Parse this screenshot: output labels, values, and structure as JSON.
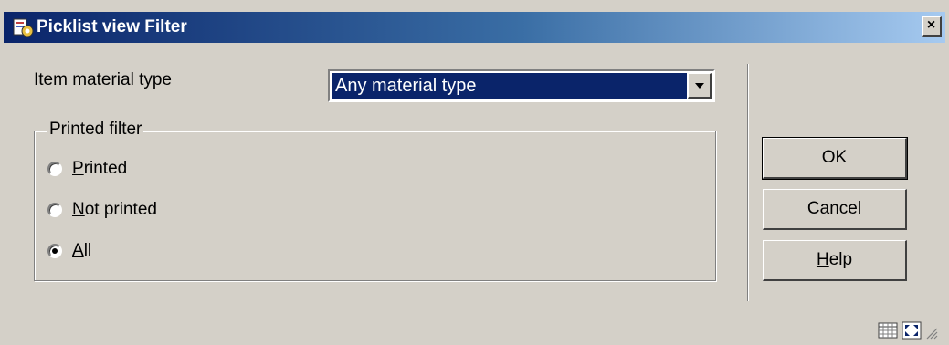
{
  "window": {
    "title": "Picklist view Filter",
    "close_label": "×",
    "accent_color": "#0a246a",
    "background_color": "#d4d0c8"
  },
  "material": {
    "label": "Item material type",
    "selected_value": "Any material type"
  },
  "printed_filter": {
    "legend": "Printed filter",
    "options": [
      {
        "underline": "P",
        "rest": "rinted",
        "checked": false
      },
      {
        "underline": "N",
        "rest": "ot printed",
        "checked": false
      },
      {
        "underline": "A",
        "rest": "ll",
        "checked": true
      }
    ]
  },
  "buttons": {
    "ok_label": "OK",
    "cancel_label": "Cancel",
    "help_underline": "H",
    "help_rest": "elp"
  },
  "icons": [
    "app-icon",
    "close-icon",
    "dropdown-arrow-icon",
    "grid-icon",
    "expand-icon",
    "resize-grip-icon"
  ]
}
